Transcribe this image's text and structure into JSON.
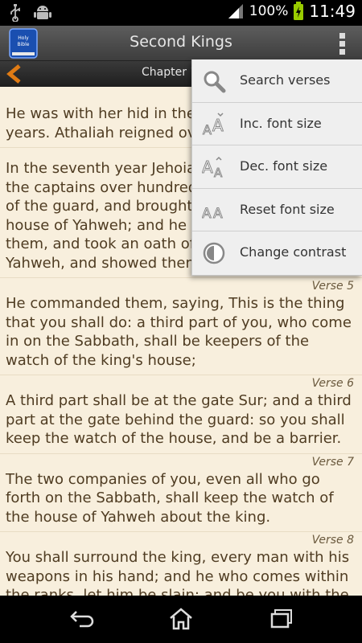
{
  "status_bar": {
    "battery_percent": "100%",
    "time": "11:49",
    "icons": [
      "usb-icon",
      "android-debug-icon",
      "signal-icon",
      "battery-charging-icon"
    ]
  },
  "action_bar": {
    "title": "Second Kings",
    "logo_text_line1": "Holy",
    "logo_text_line2": "Bible",
    "overflow_icon": "overflow-menu-icon"
  },
  "chapter_bar": {
    "chapter_label": "Chapter 1",
    "back_icon": "back-arrow-icon"
  },
  "verses": [
    {
      "label": "",
      "text": "He was with her hid in the house of Yahweh six years. Athaliah reigned over the land."
    },
    {
      "label": "",
      "text": "In the seventh year Jehoiada sent and fetched the captains over hundreds, of the Carites and of the guard, and brought them to him into the house of Yahweh; and he made a covenant with them, and took an oath of them in the house of Yahweh, and showed them the king's son."
    },
    {
      "label": "Verse 5",
      "text": "He commanded them, saying, This is the thing that you shall do: a third part of you, who come in on the Sabbath, shall be keepers of the watch of the king's house;"
    },
    {
      "label": "Verse 6",
      "text": "A third part shall be at the gate Sur; and a third part at the gate behind the guard: so you shall keep the watch of the house, and be a barrier."
    },
    {
      "label": "Verse 7",
      "text": "The two companies of you, even all who go forth on the Sabbath, shall keep the watch of the house of Yahweh about the king."
    },
    {
      "label": "Verse 8",
      "text": "You shall surround the king, every man with his weapons in his hand; and he who comes within the ranks, let him be slain: and be you with the king when he goes out, and when he comes in."
    }
  ],
  "menu": {
    "items": [
      {
        "label": "Search verses",
        "icon": "search-icon"
      },
      {
        "label": "Inc. font size",
        "icon": "increase-font-icon"
      },
      {
        "label": "Dec. font size",
        "icon": "decrease-font-icon"
      },
      {
        "label": "Reset font size",
        "icon": "reset-font-icon"
      },
      {
        "label": "Change contrast",
        "icon": "contrast-icon"
      }
    ]
  },
  "nav_bar": {
    "icons": [
      "back-nav-icon",
      "home-nav-icon",
      "recent-apps-icon"
    ]
  },
  "colors": {
    "page_background": "#f8efdd",
    "verse_text": "#4f3c22",
    "accent_orange": "#e07b14",
    "menu_background": "#efefef"
  }
}
